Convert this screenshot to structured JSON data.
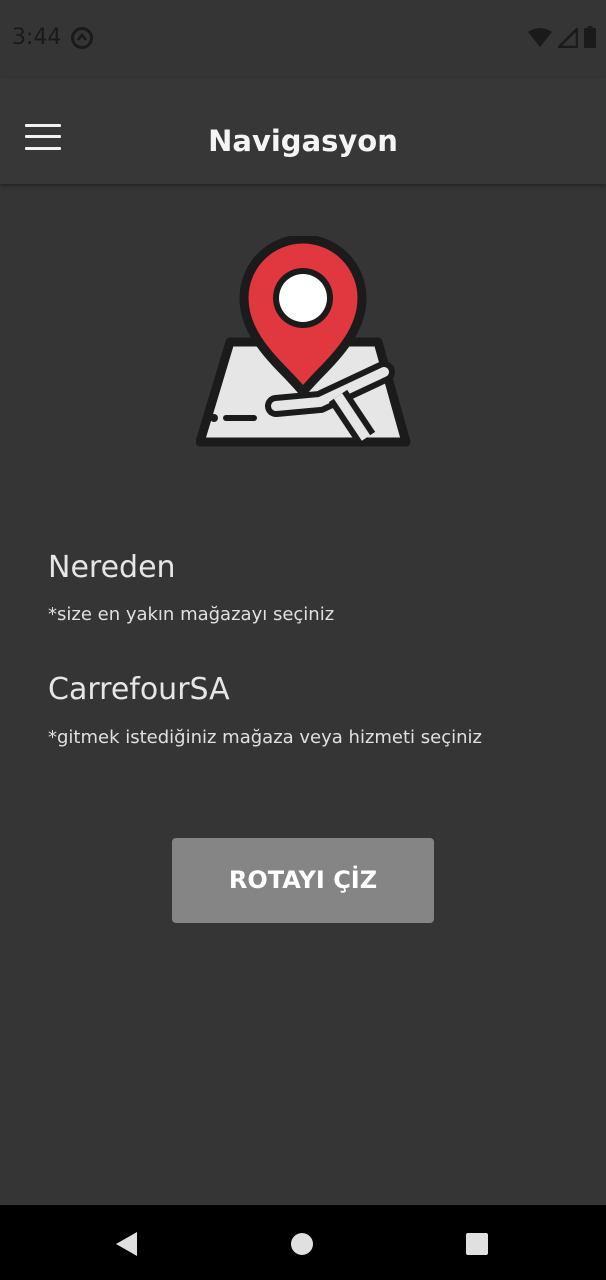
{
  "status_bar": {
    "time": "3:44",
    "icons": [
      "sync-icon",
      "wifi-icon",
      "signal-icon",
      "battery-icon"
    ]
  },
  "app_bar": {
    "title": "Navigasyon",
    "menu_icon": "hamburger-menu-icon"
  },
  "illustration": {
    "icon": "map-pin-icon",
    "colors": {
      "pin": "#e0383e",
      "map": "#e8e8e8",
      "outline": "#1b1b1b"
    }
  },
  "form": {
    "from_label": "Nereden",
    "from_hint": "*size en yakın mağazayı seçiniz",
    "to_label": "CarrefourSA",
    "to_hint": "*gitmek istediğiniz mağaza veya hizmeti seçiniz"
  },
  "actions": {
    "route_button": "ROTAYI ÇİZ"
  },
  "nav_bar": {
    "icons": [
      "back-icon",
      "home-icon",
      "recents-icon"
    ]
  },
  "colors": {
    "background": "#353535",
    "button": "#858585",
    "nav_bar": "#000000"
  }
}
